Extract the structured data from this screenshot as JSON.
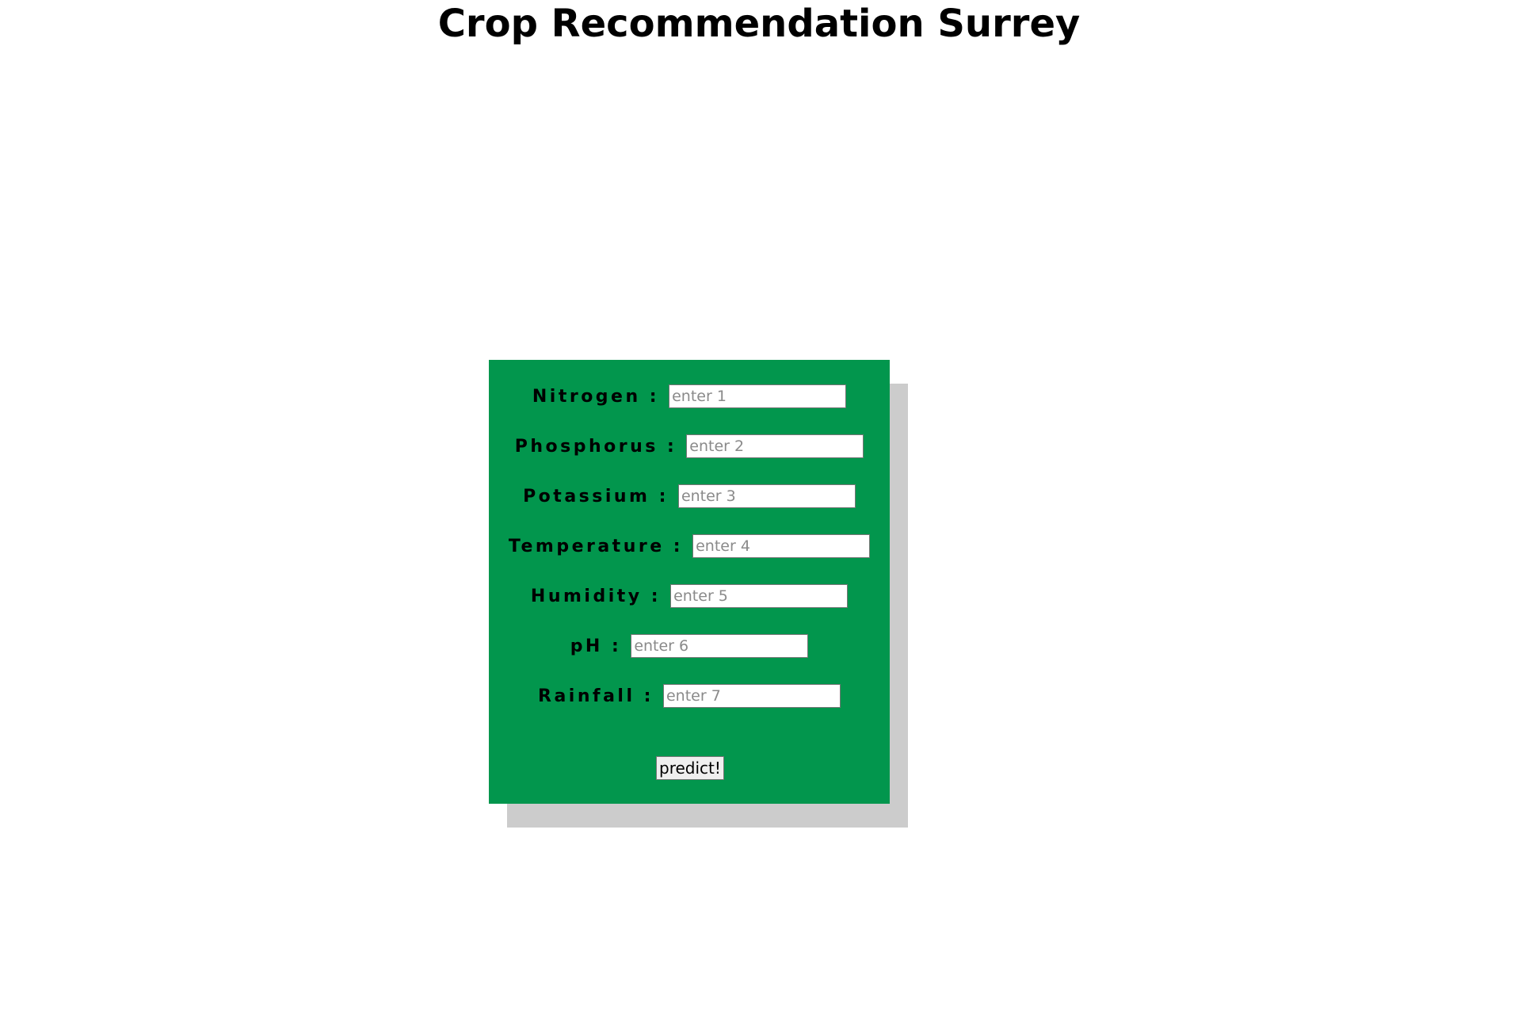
{
  "page": {
    "title": "Crop Recommendation Surrey"
  },
  "colors": {
    "card_background": "#02964d",
    "card_shadow": "#cccccc"
  },
  "form": {
    "fields": [
      {
        "label": "Nitrogen :",
        "placeholder": "enter 1",
        "value": ""
      },
      {
        "label": "Phosphorus :",
        "placeholder": "enter 2",
        "value": ""
      },
      {
        "label": "Potassium :",
        "placeholder": "enter 3",
        "value": ""
      },
      {
        "label": "Temperature :",
        "placeholder": "enter 4",
        "value": ""
      },
      {
        "label": "Humidity :",
        "placeholder": "enter 5",
        "value": ""
      },
      {
        "label": "pH :",
        "placeholder": "enter 6",
        "value": ""
      },
      {
        "label": "Rainfall :",
        "placeholder": "enter 7",
        "value": ""
      }
    ],
    "submit_label": "predict!"
  }
}
